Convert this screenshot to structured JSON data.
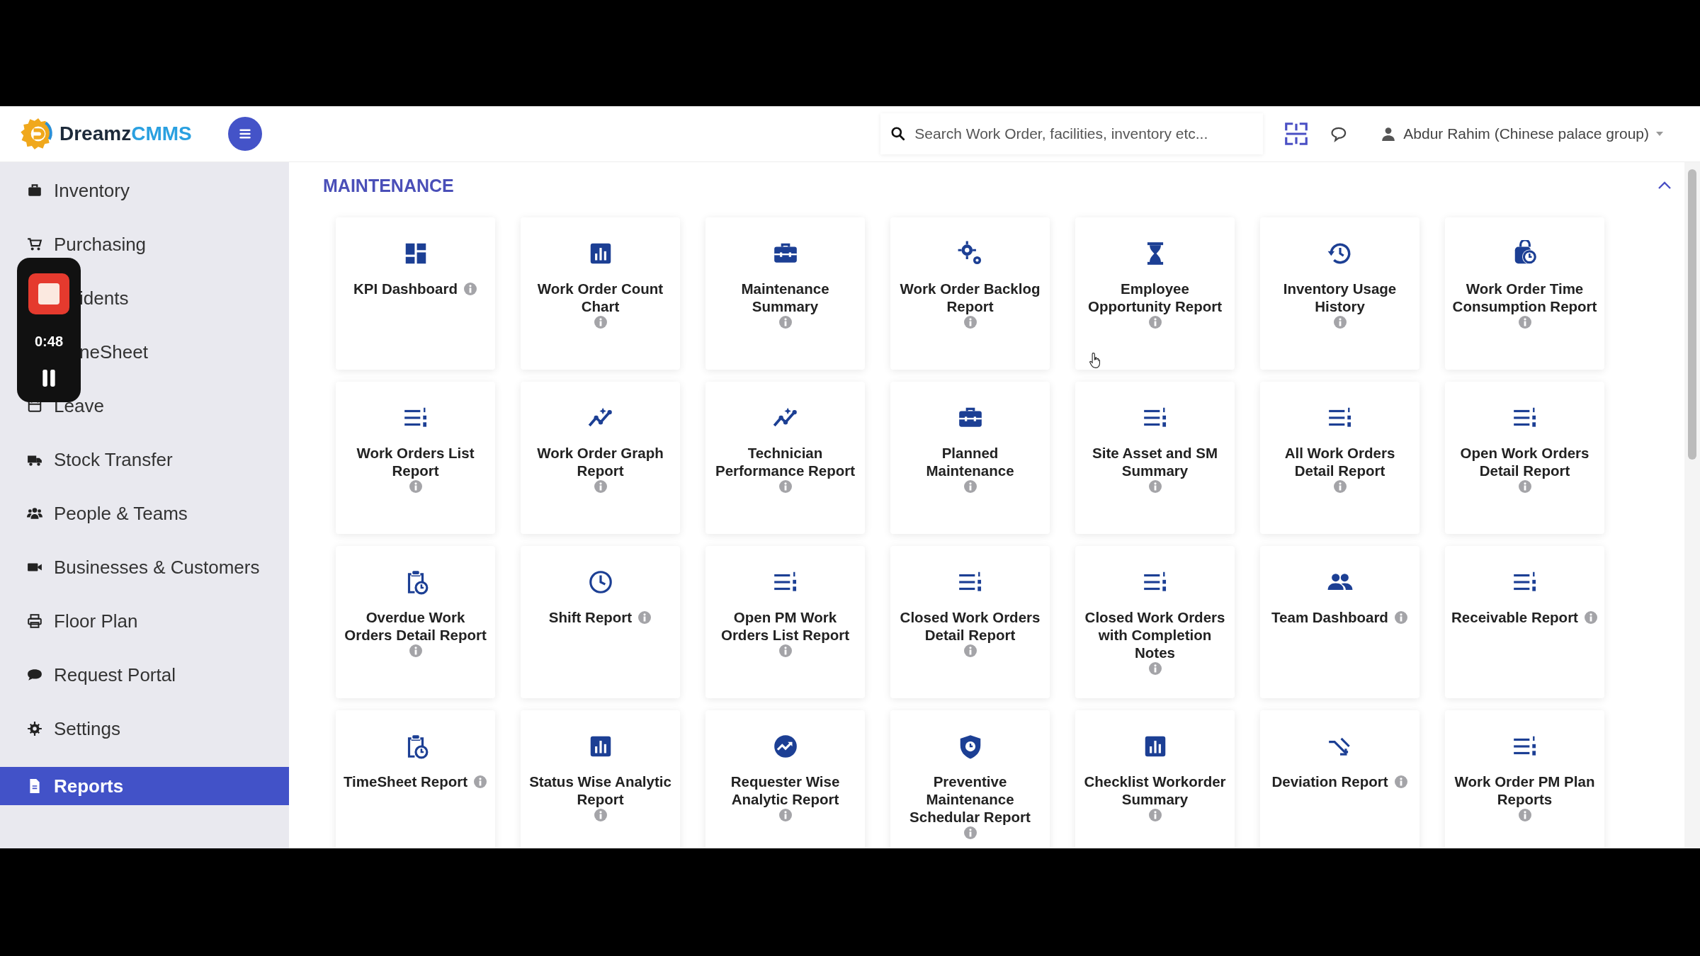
{
  "header": {
    "brand": {
      "name": "Dreamz",
      "suffix": "CMMS"
    },
    "search": {
      "placeholder": "Search Work Order, facilities, inventory etc..."
    },
    "user": "Abdur Rahim (Chinese palace group)"
  },
  "sidebar": {
    "items": [
      {
        "label": "Inventory",
        "kind": "briefcase",
        "selected": false
      },
      {
        "label": "Purchasing",
        "kind": "cart",
        "selected": false
      },
      {
        "label": "idents",
        "kind": "none",
        "selected": false
      },
      {
        "label": "neSheet",
        "kind": "none",
        "selected": false
      },
      {
        "label": "Leave",
        "kind": "calendar",
        "selected": false
      },
      {
        "label": "Stock Transfer",
        "kind": "truck",
        "selected": false
      },
      {
        "label": "People & Teams",
        "kind": "people",
        "selected": false
      },
      {
        "label": "Businesses & Customers",
        "kind": "camera",
        "selected": false
      },
      {
        "label": "Floor Plan",
        "kind": "printer",
        "selected": false
      },
      {
        "label": "Request Portal",
        "kind": "chat",
        "selected": false
      },
      {
        "label": "Settings",
        "kind": "gear",
        "selected": false
      },
      {
        "label": "Reports",
        "kind": "file",
        "selected": true
      }
    ]
  },
  "recorder": {
    "time": "0:48"
  },
  "section": {
    "title": "MAINTENANCE",
    "expanded": true,
    "cards": [
      {
        "title": "KPI Dashboard",
        "kind": "dashboard"
      },
      {
        "title": "Work Order Count Chart",
        "kind": "barchart"
      },
      {
        "title": "Maintenance Summary",
        "kind": "toolbox"
      },
      {
        "title": "Work Order Backlog Report",
        "kind": "gears"
      },
      {
        "title": "Employee Opportunity Report",
        "kind": "hourglass"
      },
      {
        "title": "Inventory Usage History",
        "kind": "history"
      },
      {
        "title": "Work Order Time Consumption Report",
        "kind": "clockbag"
      },
      {
        "title": "Work Orders List Report",
        "kind": "list"
      },
      {
        "title": "Work Order Graph Report",
        "kind": "graph"
      },
      {
        "title": "Technician Performance Report",
        "kind": "graph"
      },
      {
        "title": "Planned Maintenance",
        "kind": "toolbox"
      },
      {
        "title": "Site Asset and SM Summary",
        "kind": "list"
      },
      {
        "title": "All Work Orders Detail Report",
        "kind": "list"
      },
      {
        "title": "Open Work Orders Detail Report",
        "kind": "list"
      },
      {
        "title": "Overdue Work Orders Detail Report",
        "kind": "clipboard"
      },
      {
        "title": "Shift Report",
        "kind": "clock"
      },
      {
        "title": "Open PM Work Orders List Report",
        "kind": "list"
      },
      {
        "title": "Closed Work Orders Detail Report",
        "kind": "list"
      },
      {
        "title": "Closed Work Orders with Completion Notes",
        "kind": "list"
      },
      {
        "title": "Team Dashboard",
        "kind": "people"
      },
      {
        "title": "Receivable Report",
        "kind": "list"
      },
      {
        "title": "TimeSheet Report",
        "kind": "clipboard"
      },
      {
        "title": "Status Wise Analytic Report",
        "kind": "barchart"
      },
      {
        "title": "Requester Wise Analytic Report",
        "kind": "trend"
      },
      {
        "title": "Preventive Maintenance Schedular Report",
        "kind": "shield"
      },
      {
        "title": "Checklist Workorder Summary",
        "kind": "barchart"
      },
      {
        "title": "Deviation Report",
        "kind": "shuffle"
      },
      {
        "title": "Work Order PM Plan Reports",
        "kind": "list"
      }
    ]
  }
}
